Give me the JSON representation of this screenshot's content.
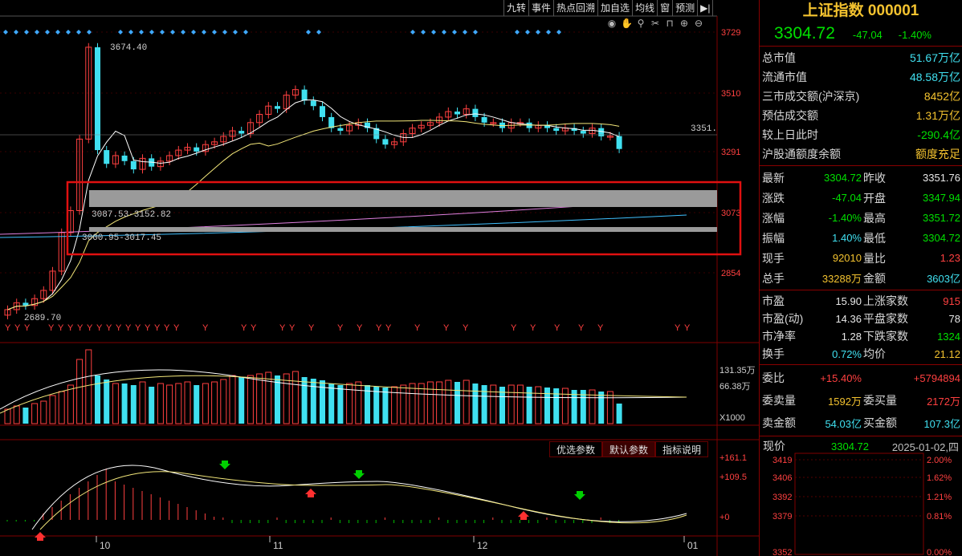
{
  "toolbar": {
    "buttons": [
      "九转",
      "事件",
      "热点回溯",
      "加自选",
      "均线",
      "窗",
      "预测"
    ],
    "collapse_label": "▶|"
  },
  "toolbar_icons": [
    "eye-icon",
    "hand-icon",
    "pin-icon",
    "scissors-icon",
    "lock-icon",
    "zoom-in-icon",
    "zoom-out-icon"
  ],
  "price_axis": [
    "3729",
    "3510",
    "3291",
    "3073",
    "2854"
  ],
  "annotations": {
    "high": "3674.40",
    "low": "2689.70",
    "zone1": "3087.53-3152.82",
    "zone2": "3000.95-3017.45",
    "last": "3351."
  },
  "volume_axis": [
    "131.35万",
    "66.38万",
    "X1000"
  ],
  "macd_axis": [
    "+161.1",
    "+109.5",
    "+0"
  ],
  "x_axis": [
    "10",
    "11",
    "12",
    "01"
  ],
  "param_tabs": [
    "优选参数",
    "默认参数",
    "指标说明"
  ],
  "header": {
    "title": "上证指数 000001",
    "price": "3304.72",
    "change": "-47.04",
    "change_pct": "-1.40%"
  },
  "market_stats": [
    {
      "label": "总市值",
      "value": "51.67万亿"
    },
    {
      "label": "流通市值",
      "value": "48.58万亿"
    },
    {
      "label": "三市成交额(沪深京)",
      "value": "8452亿"
    },
    {
      "label": "预估成交额",
      "value": "1.31万亿"
    },
    {
      "label": "较上日此时",
      "value": "-290.4亿"
    },
    {
      "label": "沪股通额度余额",
      "value": "额度充足"
    }
  ],
  "quote_grid": [
    {
      "l1": "最新",
      "v1": "3304.72",
      "l2": "昨收",
      "v2": "3351.76"
    },
    {
      "l1": "涨跌",
      "v1": "-47.04",
      "l2": "开盘",
      "v2": "3347.94"
    },
    {
      "l1": "涨幅",
      "v1": "-1.40%",
      "l2": "最高",
      "v2": "3351.72"
    },
    {
      "l1": "振幅",
      "v1": "1.40%",
      "l2": "最低",
      "v2": "3304.72"
    },
    {
      "l1": "现手",
      "v1": "92010",
      "l2": "量比",
      "v2": "1.23"
    },
    {
      "l1": "总手",
      "v1": "33288万",
      "l2": "金额",
      "v2": "3603亿"
    }
  ],
  "ratio_grid": [
    {
      "l1": "市盈",
      "v1": "15.90",
      "l2": "上涨家数",
      "v2": "915"
    },
    {
      "l1": "市盈(动)",
      "v1": "14.36",
      "l2": "平盘家数",
      "v2": "78"
    },
    {
      "l1": "市净率",
      "v1": "1.28",
      "l2": "下跌家数",
      "v2": "1324"
    },
    {
      "l1": "换手",
      "v1": "0.72%",
      "l2": "均价",
      "v2": "21.12"
    }
  ],
  "order_grid": [
    {
      "l1": "委比",
      "v1": "+15.40%",
      "l2": "",
      "v2": "+5794894"
    },
    {
      "l1": "委卖量",
      "v1": "1592万",
      "l2": "委买量",
      "v2": "2172万"
    },
    {
      "l1": "卖金额",
      "v1": "54.03亿",
      "l2": "买金额",
      "v2": "107.3亿"
    }
  ],
  "mini_chart": {
    "label": "现价",
    "price": "3304.72",
    "date": "2025-01-02,四",
    "left_axis": [
      "3419",
      "3406",
      "3392",
      "3379",
      "3352"
    ],
    "right_axis": [
      "2.00%",
      "1.62%",
      "1.21%",
      "0.81%",
      "0.00%"
    ]
  },
  "colors": {
    "up": "#ff4040",
    "down": "#40e0f0",
    "ma5": "#ffffff",
    "ma10": "#f3e77a",
    "ma60": "#e080e0",
    "ma120": "#40c0ff",
    "grid": "#800000"
  }
}
